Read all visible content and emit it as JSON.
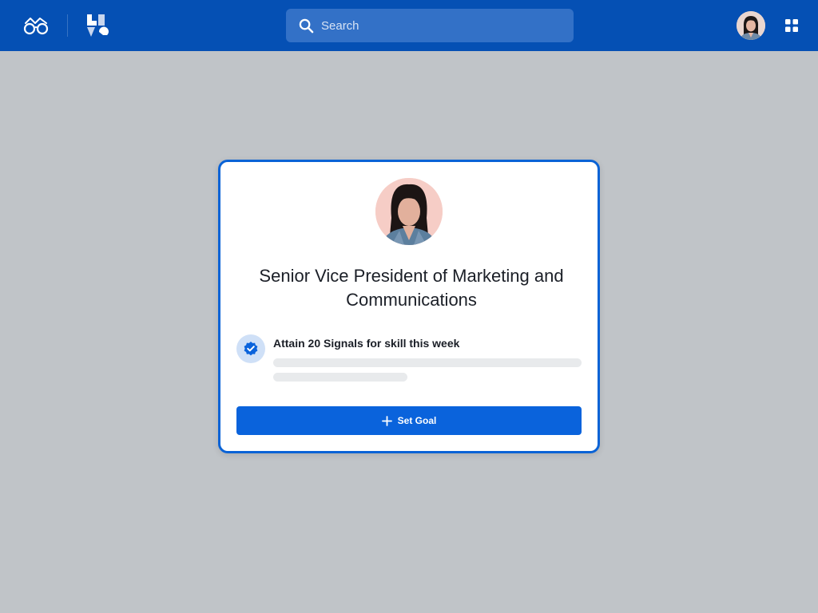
{
  "header": {
    "logo_icon": "glasses-logo-icon",
    "brand_icon": "live-logo-icon",
    "search": {
      "placeholder": "Search",
      "value": "",
      "icon": "search-icon"
    },
    "user_avatar": "user-avatar",
    "apps_icon": "apps-grid-icon"
  },
  "card": {
    "title": "Senior Vice President of Marketing and Communications",
    "goal": {
      "icon": "verified-badge-icon",
      "text": "Attain 20 Signals for skill this week"
    },
    "button": {
      "label": "Set Goal",
      "icon": "plus-icon"
    }
  },
  "colors": {
    "header_bg": "#0550b4",
    "page_bg": "#c0c4c8",
    "accent": "#0a63dc",
    "card_border": "#0a63d6",
    "badge_bg": "#cfe0f7"
  }
}
